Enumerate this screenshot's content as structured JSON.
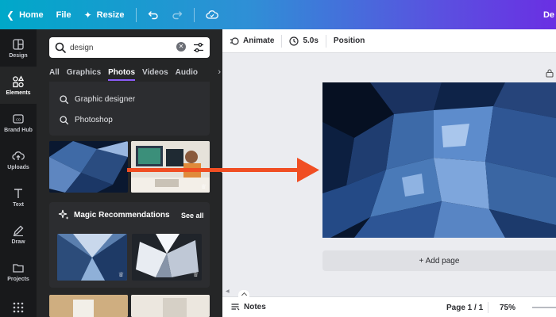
{
  "topbar": {
    "home_label": "Home",
    "file_label": "File",
    "resize_label": "Resize",
    "account_label": "De"
  },
  "rail": {
    "items": [
      {
        "label": "Design"
      },
      {
        "label": "Elements"
      },
      {
        "label": "Brand Hub"
      },
      {
        "label": "Uploads"
      },
      {
        "label": "Text"
      },
      {
        "label": "Draw"
      },
      {
        "label": "Projects"
      }
    ]
  },
  "search": {
    "value": "design"
  },
  "tabs": [
    {
      "label": "All"
    },
    {
      "label": "Graphics"
    },
    {
      "label": "Photos"
    },
    {
      "label": "Videos"
    },
    {
      "label": "Audio"
    }
  ],
  "suggestions": [
    {
      "label": "Graphic designer"
    },
    {
      "label": "Photoshop"
    }
  ],
  "magic": {
    "title": "Magic Recommendations",
    "see_all": "See all"
  },
  "context_bar": {
    "animate_label": "Animate",
    "duration_label": "5.0s",
    "position_label": "Position"
  },
  "canvas": {
    "add_page_label": "+ Add page"
  },
  "bottombar": {
    "notes_label": "Notes",
    "page_label": "Page 1 / 1",
    "zoom_label": "75%"
  },
  "colors": {
    "accent": "#8b5cf6",
    "annotation_arrow": "#f04e23",
    "panel_bg": "#252627",
    "rail_bg": "#18191b"
  }
}
